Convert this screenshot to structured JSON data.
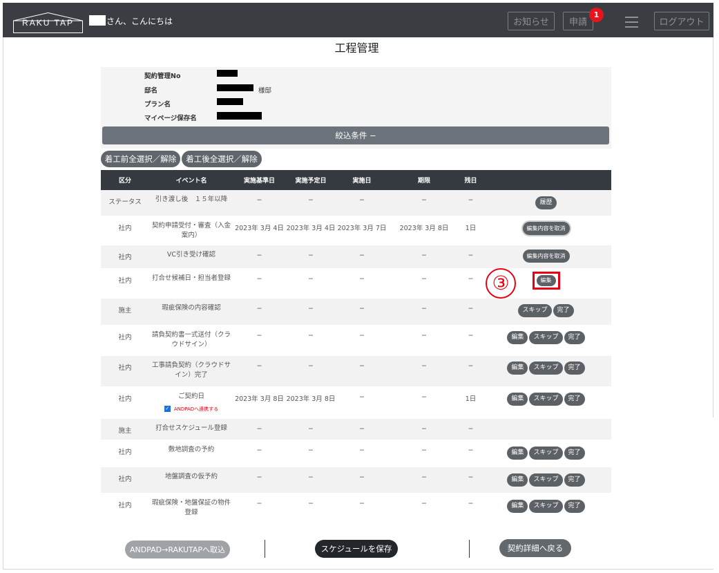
{
  "header": {
    "logo": "RAKU TAP",
    "greeting": "さん、こんにちは",
    "notice_label": "お知らせ",
    "apply_label": "申請",
    "apply_badge": "1",
    "logout_label": "ログアウト"
  },
  "page_title": "工程管理",
  "info": {
    "contract_label": "契約管理No",
    "house_label": "邸名",
    "house_suffix": "様邸",
    "plan_label": "プラン名",
    "mypage_label": "マイページ保存名"
  },
  "filter_label": "絞込条件 −",
  "select_before_label": "着工前全選択／解除",
  "select_after_label": "着工後全選択／解除",
  "columns": [
    "区分",
    "イベント名",
    "実施基準日",
    "実施予定日",
    "実施日",
    "期限",
    "残日"
  ],
  "rows": [
    {
      "kubun": "ステータス",
      "event": "引き渡し後　１５年以降",
      "base": "−",
      "plan": "−",
      "done": "−",
      "due": "−",
      "remain": "−",
      "buttons": [
        "履歴"
      ]
    },
    {
      "kubun": "社内",
      "event": "契約申請受付・審査（入金案内）",
      "base": "2023年 3月 4日",
      "plan": "2023年 3月 4日",
      "done": "2023年 3月 7日",
      "due": "2023年 3月 8日",
      "remain": "1日",
      "buttons": [
        "編集内容を取消"
      ]
    },
    {
      "kubun": "社内",
      "event": "VC引き受け確認",
      "base": "−",
      "plan": "−",
      "done": "−",
      "due": "−",
      "remain": "−",
      "buttons": [
        "編集内容を取消"
      ]
    },
    {
      "kubun": "社内",
      "event": "打合せ候補日・担当者登録",
      "base": "−",
      "plan": "−",
      "done": "−",
      "due": "−",
      "remain": "−",
      "buttons": [
        "編集"
      ]
    },
    {
      "kubun": "施主",
      "event": "瑕疵保険の内容確認",
      "base": "−",
      "plan": "−",
      "done": "−",
      "due": "−",
      "remain": "−",
      "buttons": [
        "スキップ",
        "完了"
      ]
    },
    {
      "kubun": "社内",
      "event": "請負契約書一式送付（クラウドサイン）",
      "base": "−",
      "plan": "−",
      "done": "−",
      "due": "−",
      "remain": "−",
      "buttons": [
        "編集",
        "スキップ",
        "完了"
      ]
    },
    {
      "kubun": "社内",
      "event": "工事請負契約（クラウドサイン）完了",
      "base": "−",
      "plan": "−",
      "done": "−",
      "due": "−",
      "remain": "−",
      "buttons": [
        "編集",
        "スキップ",
        "完了"
      ]
    },
    {
      "kubun": "社内",
      "event": "ご契約日",
      "base": "2023年 3月 8日",
      "plan": "2023年 3月 8日",
      "done": "−",
      "due": "−",
      "remain": "1日",
      "buttons": [
        "編集",
        "スキップ",
        "完了"
      ],
      "checkbox_label": "ANDPADへ連携する"
    },
    {
      "kubun": "施主",
      "event": "打合せスケジュール登録",
      "base": "−",
      "plan": "−",
      "done": "−",
      "due": "−",
      "remain": "−",
      "buttons": []
    },
    {
      "kubun": "社内",
      "event": "敷地調査の予約",
      "base": "−",
      "plan": "−",
      "done": "−",
      "due": "−",
      "remain": "−",
      "buttons": [
        "編集",
        "スキップ",
        "完了"
      ]
    },
    {
      "kubun": "社内",
      "event": "地盤調査の仮予約",
      "base": "−",
      "plan": "−",
      "done": "−",
      "due": "−",
      "remain": "−",
      "buttons": [
        "編集",
        "スキップ",
        "完了"
      ]
    },
    {
      "kubun": "社内",
      "event": "瑕疵保険・地盤保証の物件登録",
      "base": "−",
      "plan": "−",
      "done": "−",
      "due": "−",
      "remain": "−",
      "buttons": [
        "編集",
        "スキップ",
        "完了"
      ]
    }
  ],
  "annotation": "③",
  "footer": {
    "import_label": "ANDPAD→RAKUTAPへ取込",
    "save_label": "スケジュールを保存",
    "back_label": "契約詳細へ戻る"
  },
  "colors": {
    "header_bg": "#3a3d42",
    "button": "#5c6166",
    "highlight": "#e60012",
    "checkbox": "#1e6fd9"
  }
}
